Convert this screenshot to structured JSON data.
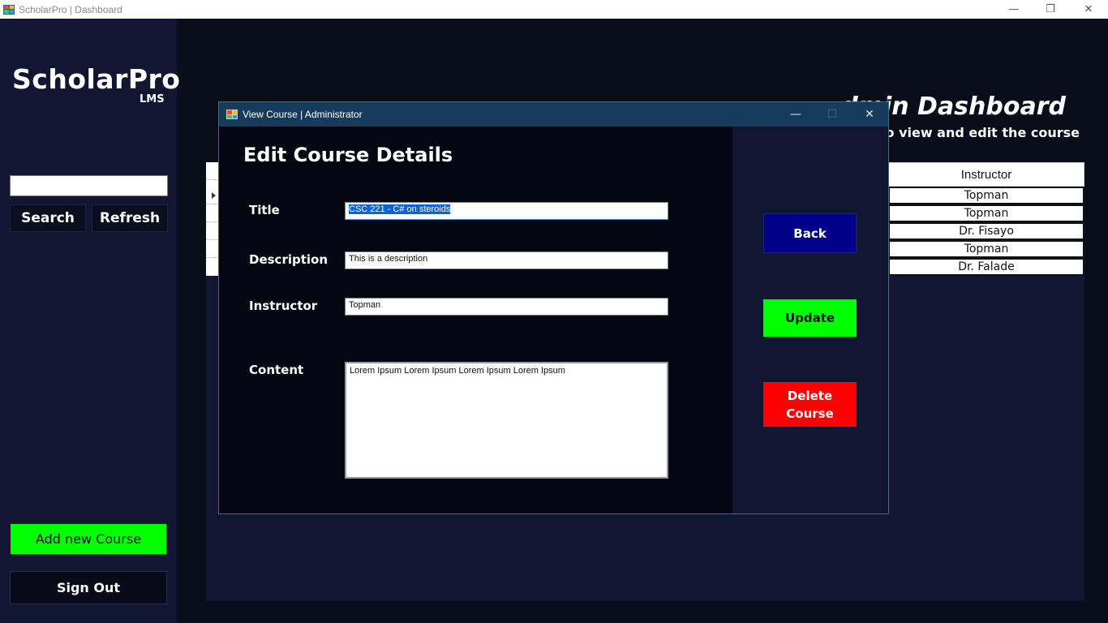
{
  "window": {
    "title": "ScholarPro | Dashboard",
    "minimize": "—",
    "restore": "❐",
    "close": "✕"
  },
  "sidebar": {
    "brand": "ScholarPro",
    "brand_sub": "LMS",
    "search_value": "",
    "search_button": "Search",
    "refresh_button": "Refresh",
    "add_course_button": "Add new Course",
    "sign_out_button": "Sign Out"
  },
  "header": {
    "title": "dmin Dashboard",
    "subtitle": "ll to view and edit the course"
  },
  "grid": {
    "visible_column_header": "Instructor",
    "instructors": [
      "Topman",
      "Topman",
      "Dr. Fisayo",
      "Topman",
      "Dr. Falade"
    ]
  },
  "dialog": {
    "title": "View Course | Administrator",
    "minimize": "—",
    "maximize": "☐",
    "close": "✕",
    "heading": "Edit Course Details",
    "fields": {
      "title_label": "Title",
      "title_value": "CSC 221 - C# on steroids",
      "description_label": "Description",
      "description_value": "This is a description",
      "instructor_label": "Instructor",
      "instructor_value": "Topman",
      "content_label": "Content",
      "content_value": "Lorem Ipsum Lorem Ipsum Lorem Ipsum Lorem Ipsum"
    },
    "buttons": {
      "back": "Back",
      "update": "Update",
      "delete": "Delete Course"
    }
  },
  "colors": {
    "sidebar_bg": "#111733",
    "page_bg": "#0a0d1a",
    "dialog_bg": "#050813",
    "dialog_title_bg": "#173b5a",
    "green": "#00ff00",
    "red": "#ff0000",
    "navy": "#00008b"
  }
}
